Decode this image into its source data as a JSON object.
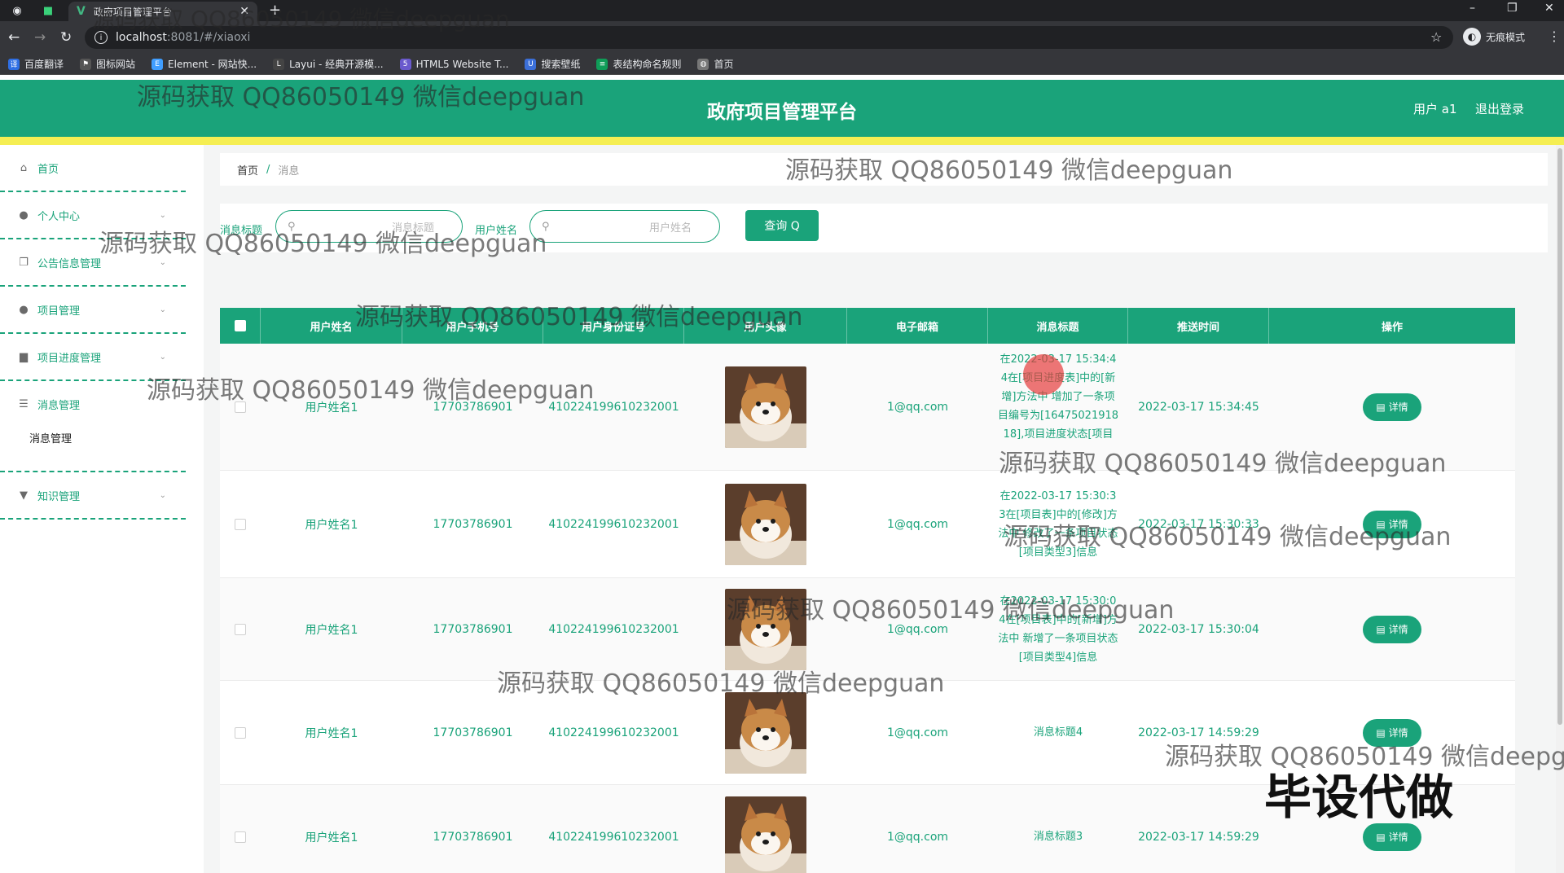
{
  "browser": {
    "tab_title": "政府项目管理平台",
    "url_host": "localhost",
    "url_path": ":8081/#/xiaoxi",
    "incognito_label": "无痕模式",
    "bookmarks": [
      {
        "label": "百度翻译",
        "color": "#2f6fe4"
      },
      {
        "label": "图标网站",
        "color": "#555555"
      },
      {
        "label": "Element - 网站快...",
        "color": "#409eff"
      },
      {
        "label": "Layui - 经典开源模...",
        "color": "#444444"
      },
      {
        "label": "HTML5 Website T...",
        "color": "#6a5acd"
      },
      {
        "label": "搜索壁纸",
        "color": "#3b6fd8"
      },
      {
        "label": "表结构命名规则",
        "color": "#0f9d58"
      },
      {
        "label": "首页",
        "color": "#777777"
      }
    ]
  },
  "header": {
    "title": "政府项目管理平台",
    "user": "用户 a1",
    "logout": "退出登录",
    "bg_color": "#1aa37a",
    "strip_color": "#f5ee53"
  },
  "sidebar": {
    "items": [
      {
        "label": "首页",
        "icon": "home-icon"
      },
      {
        "label": "个人中心",
        "icon": "user-icon"
      },
      {
        "label": "公告信息管理",
        "icon": "copy-icon"
      },
      {
        "label": "项目管理",
        "icon": "user-icon"
      },
      {
        "label": "项目进度管理",
        "icon": "briefcase-icon"
      },
      {
        "label": "消息管理",
        "icon": "menu-icon"
      },
      {
        "label": "知识管理",
        "icon": "pin-icon"
      }
    ],
    "sub_item": "消息管理"
  },
  "breadcrumb": {
    "home": "首页",
    "sep": "/",
    "current": "消息"
  },
  "search": {
    "label1": "消息标题",
    "placeholder1": "消息标题",
    "label2": "用户姓名",
    "placeholder2": "用户姓名",
    "button": "查询 Q"
  },
  "table": {
    "headers": [
      "用户姓名",
      "用户手机号",
      "用户身份证号",
      "用户头像",
      "电子邮箱",
      "消息标题",
      "推送时间",
      "操作"
    ],
    "rows": [
      {
        "name": "用户姓名1",
        "phone": "17703786901",
        "id": "410224199610232001",
        "email": "1@qq.com",
        "title": "在2022-03-17 15:34:4 4在[项目进度表]中的[新增]方法中 增加了一条项目编号为[16475021918 18],项目进度状态[项目",
        "time": "2022-03-17 15:34:45",
        "action": "详情"
      },
      {
        "name": "用户姓名1",
        "phone": "17703786901",
        "id": "410224199610232001",
        "email": "1@qq.com",
        "title": "在2022-03-17 15:30:3 3在[项目表]中的[修改]方法中 修改了一条项目状态[项目类型3]信息",
        "time": "2022-03-17 15:30:33",
        "action": "详情"
      },
      {
        "name": "用户姓名1",
        "phone": "17703786901",
        "id": "410224199610232001",
        "email": "1@qq.com",
        "title": "在2022-03-17 15:30:0 4在[项目表]中的[新增]方法中 新增了一条项目状态[项目类型4]信息",
        "time": "2022-03-17 15:30:04",
        "action": "详情"
      },
      {
        "name": "用户姓名1",
        "phone": "17703786901",
        "id": "410224199610232001",
        "email": "1@qq.com",
        "title": "消息标题4",
        "time": "2022-03-17 14:59:29",
        "action": "详情"
      },
      {
        "name": "用户姓名1",
        "phone": "17703786901",
        "id": "410224199610232001",
        "email": "1@qq.com",
        "title": "消息标题3",
        "time": "2022-03-17 14:59:29",
        "action": "详情"
      }
    ]
  },
  "watermark": {
    "text": "源码获取 QQ86050149 微信deepguan",
    "big_text": "毕设代做"
  }
}
